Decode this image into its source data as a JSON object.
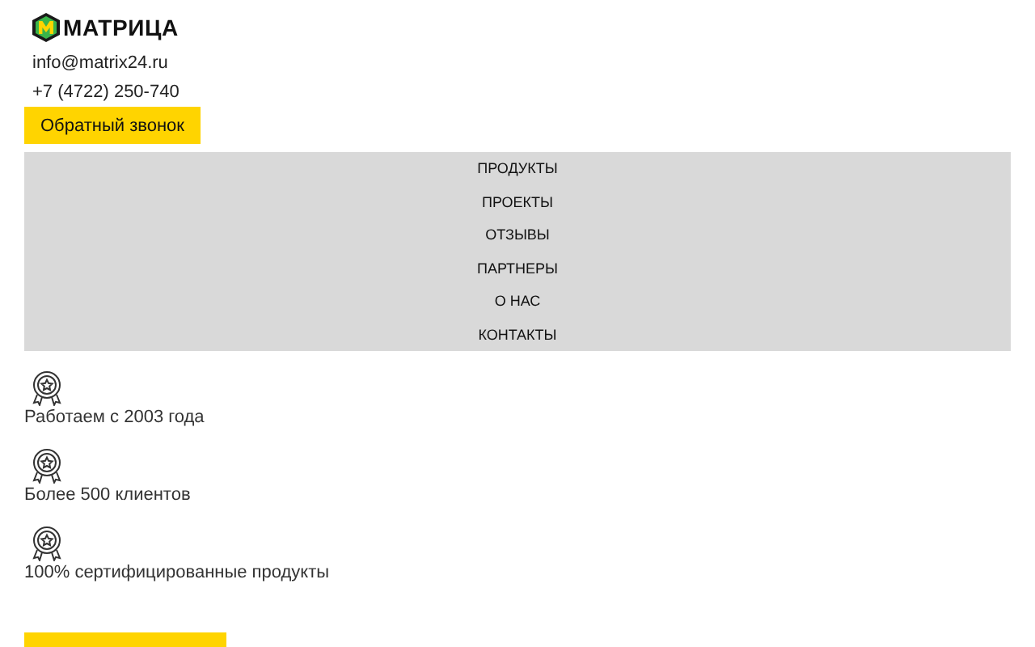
{
  "logo": {
    "text": "МАТРИЦА"
  },
  "contacts": {
    "email": "info@matrix24.ru",
    "phone": "+7 (4722) 250-740"
  },
  "callback_button": "Обратный звонок",
  "nav": [
    {
      "label": "ПРОДУКТЫ"
    },
    {
      "label": "ПРОЕКТЫ"
    },
    {
      "label": "ОТЗЫВЫ"
    },
    {
      "label": "ПАРТНЕРЫ"
    },
    {
      "label": "О НАС"
    },
    {
      "label": "КОНТАКТЫ"
    }
  ],
  "features": [
    {
      "text": "Работаем с 2003 года"
    },
    {
      "text": "Более 500 клиентов"
    },
    {
      "text": "100% сертифицированные продукты"
    }
  ]
}
